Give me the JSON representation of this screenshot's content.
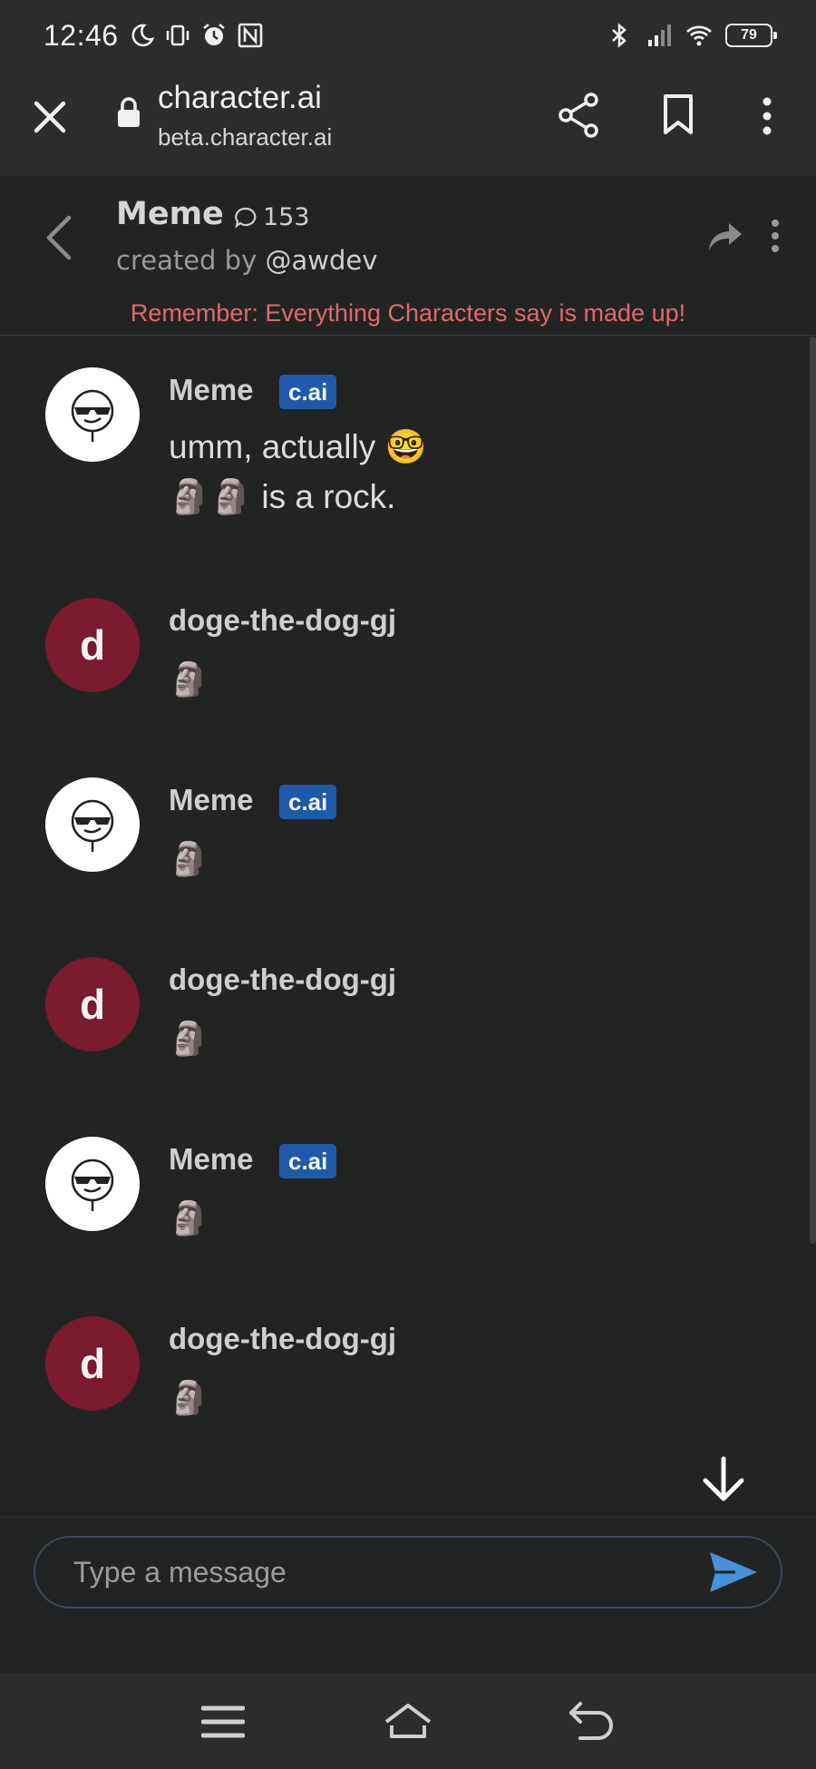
{
  "status_bar": {
    "time": "12:46",
    "battery": "79",
    "icons": [
      "moon-icon",
      "vibrate-icon",
      "alarm-icon",
      "nfc-icon",
      "bluetooth-icon",
      "signal-icon",
      "wifi-icon",
      "battery-icon"
    ]
  },
  "browser": {
    "title": "character.ai",
    "url": "beta.character.ai",
    "icons": [
      "close-icon",
      "lock-icon",
      "share-icon",
      "bookmark-icon",
      "more-vert-icon"
    ]
  },
  "chat_header": {
    "name": "Meme",
    "chat_count": "153",
    "created_by_prefix": "created by ",
    "creator": "@awdev",
    "disclaimer": "Remember: Everything Characters say is made up!"
  },
  "messages": [
    {
      "sender": "Meme",
      "badge": "c.ai",
      "lines": [
        "umm, actually 🤓",
        "🗿🗿 is a rock."
      ]
    },
    {
      "sender": "doge-the-dog-gj",
      "avatar_letter": "d",
      "lines": [
        "🗿"
      ]
    },
    {
      "sender": "Meme",
      "badge": "c.ai",
      "lines": [
        "🗿"
      ]
    },
    {
      "sender": "doge-the-dog-gj",
      "avatar_letter": "d",
      "lines": [
        "🗿"
      ]
    },
    {
      "sender": "Meme",
      "badge": "c.ai",
      "lines": [
        "🗿"
      ]
    },
    {
      "sender": "doge-the-dog-gj",
      "avatar_letter": "d",
      "lines": [
        "🗿"
      ]
    }
  ],
  "composer": {
    "placeholder": "Type a message"
  },
  "colors": {
    "background": "#222423",
    "bar": "#2c2c2e",
    "badge": "#1f5aa8",
    "user_avatar": "#7a1a2e",
    "disclaimer": "#e06a6a",
    "send": "#4a90d9"
  }
}
